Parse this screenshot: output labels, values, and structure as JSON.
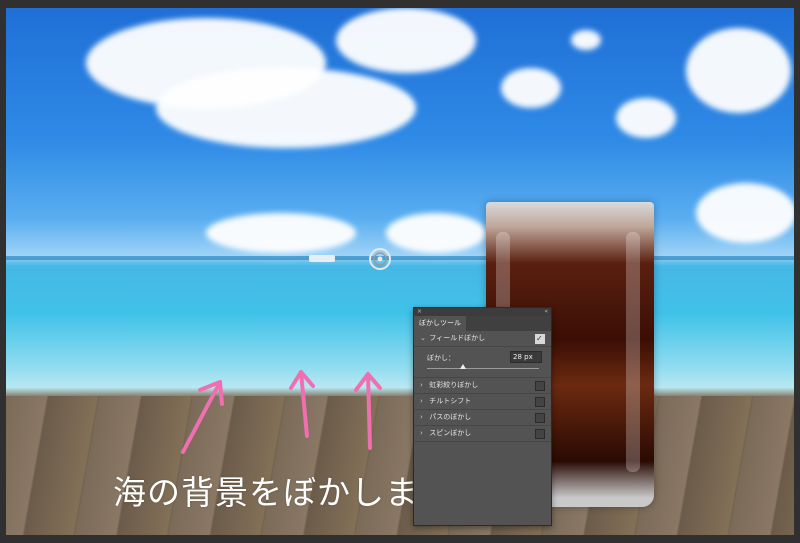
{
  "panel": {
    "title": "ぼかしツール",
    "close_glyph": "×",
    "collapse_glyph": "«",
    "sections": [
      {
        "label": "フィールドぼかし",
        "expanded": true,
        "checked": true
      },
      {
        "label": "虹彩絞りぼかし",
        "expanded": false,
        "checked": false
      },
      {
        "label": "チルトシフト",
        "expanded": false,
        "checked": false
      },
      {
        "label": "パスのぼかし",
        "expanded": false,
        "checked": false
      },
      {
        "label": "スピンぼかし",
        "expanded": false,
        "checked": false
      }
    ],
    "blur": {
      "label": "ぼかし：",
      "value": "28 px",
      "slider_fraction": 0.32
    }
  },
  "annotation": {
    "caption": "海の背景をぼかします",
    "arrow_color": "#f06fb0"
  },
  "icons": {
    "expanded": "chevron-down-icon",
    "collapsed": "chevron-right-icon",
    "pin": "blur-pin-icon"
  },
  "colors": {
    "panel_bg": "#535353",
    "panel_header": "#404040",
    "arrow": "#f06fb0"
  }
}
